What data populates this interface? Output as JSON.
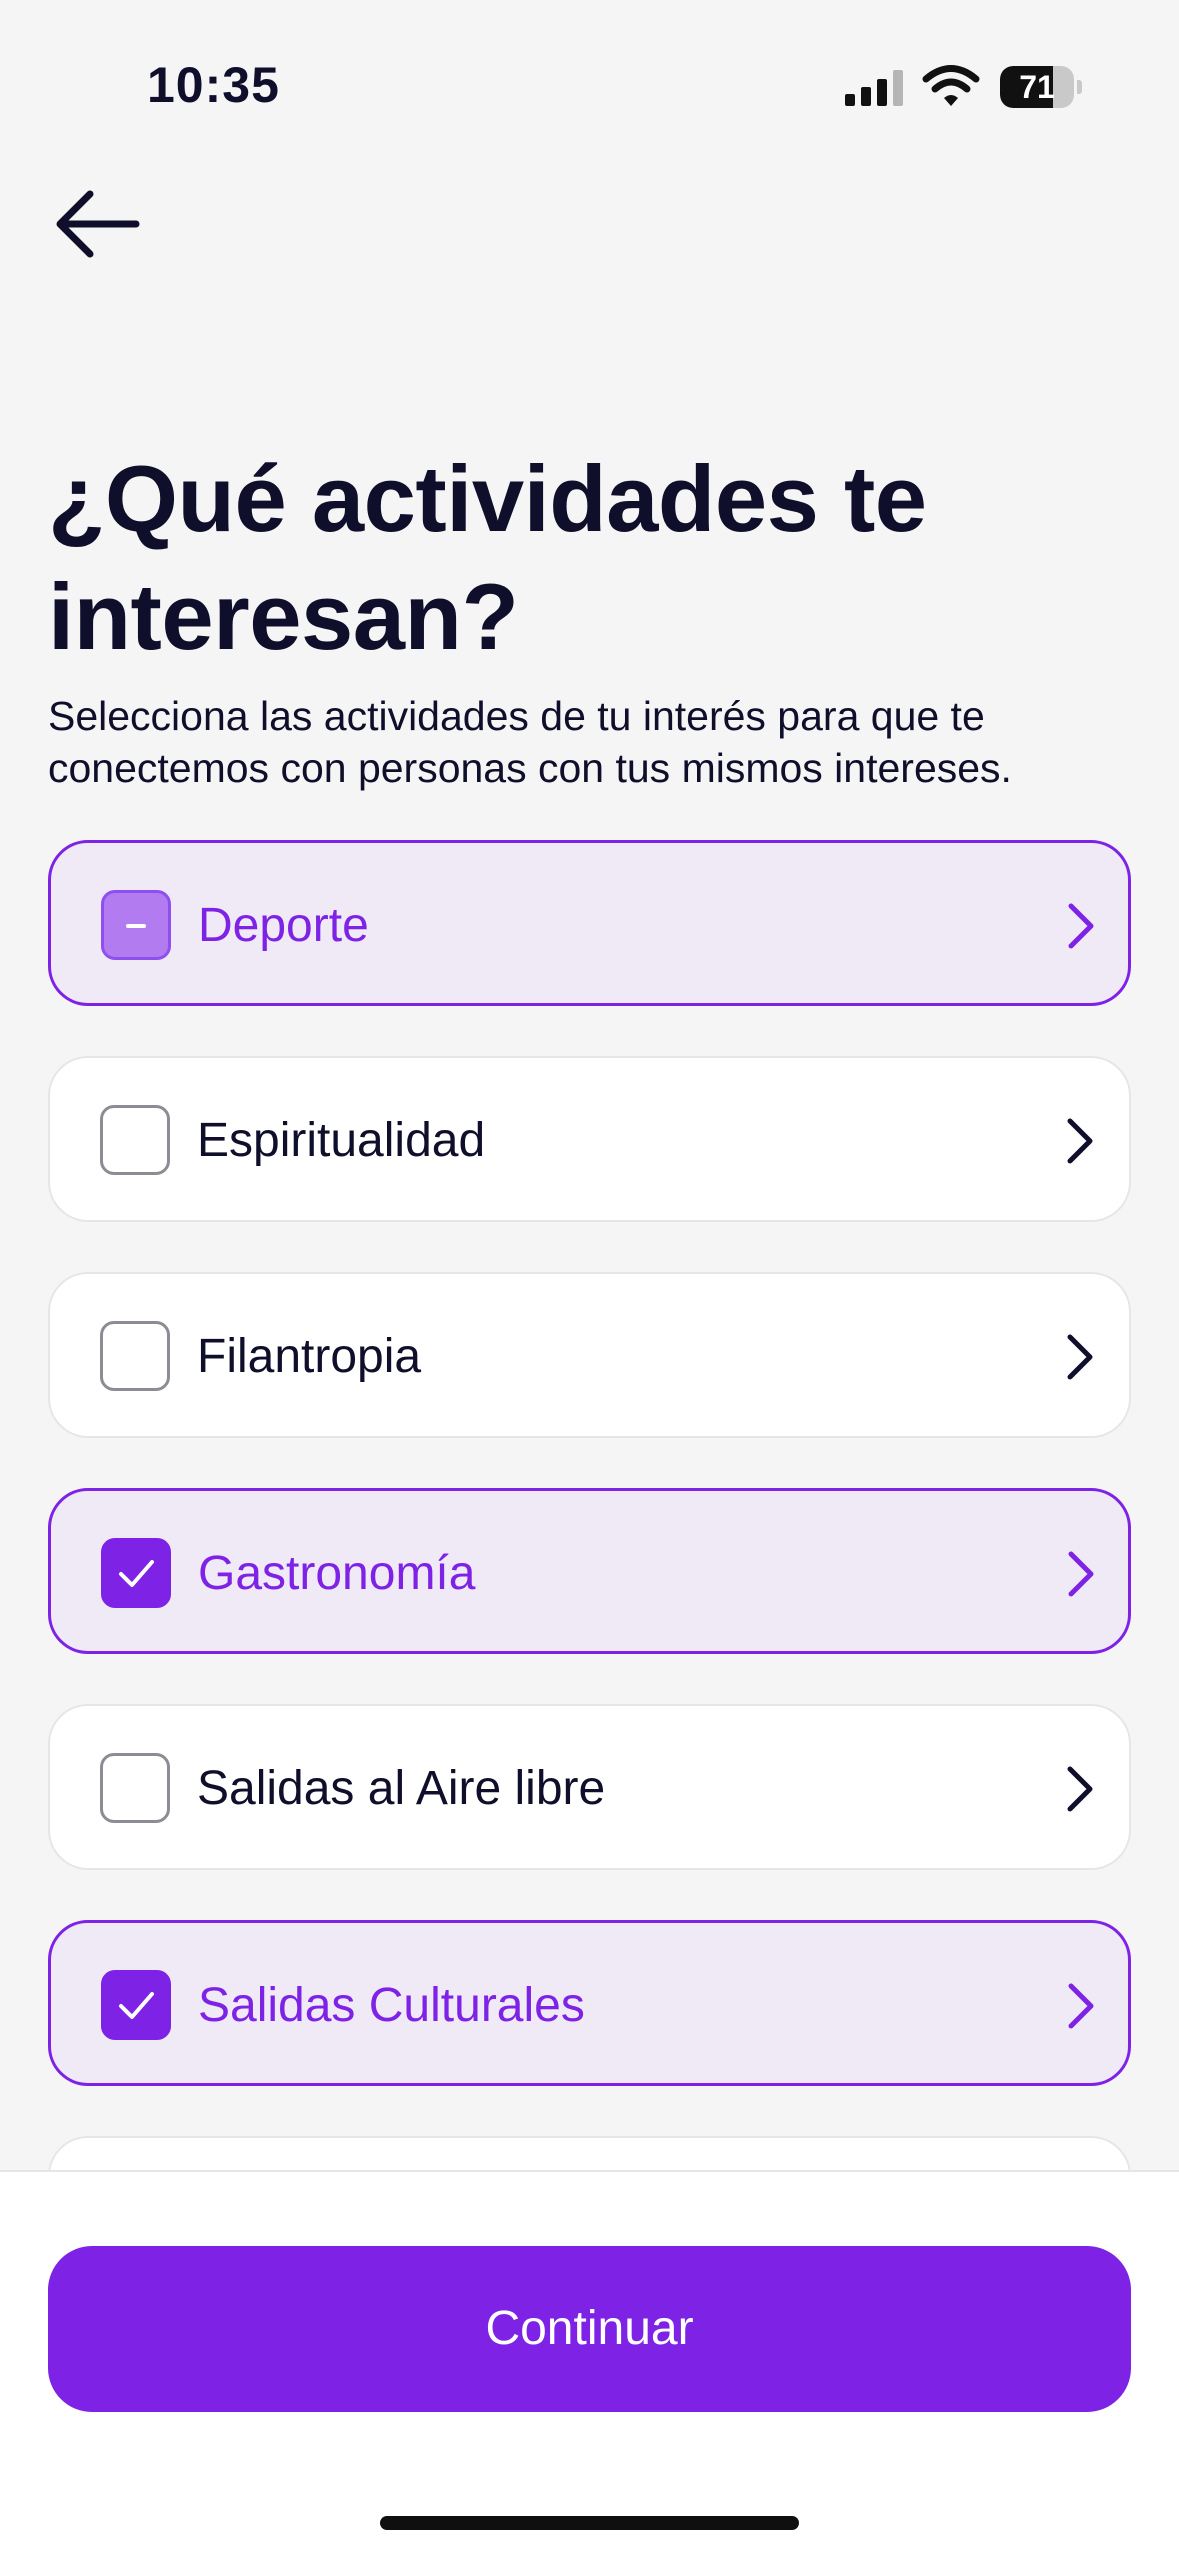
{
  "status_bar": {
    "time": "10:35",
    "battery_level": 71,
    "icons": [
      "cellular-signal-icon",
      "wifi-icon",
      "battery-icon"
    ]
  },
  "navigation": {
    "back_icon": "arrow-left-icon"
  },
  "header": {
    "title": "¿Qué actividades te interesan?",
    "subtitle": "Selecciona las actividades de tu interés para que te conectemos con personas con tus mismos intereses."
  },
  "categories": [
    {
      "label": "Deporte",
      "state": "partial"
    },
    {
      "label": "Espiritualidad",
      "state": "unchecked"
    },
    {
      "label": "Filantropia",
      "state": "unchecked"
    },
    {
      "label": "Gastronomía",
      "state": "checked"
    },
    {
      "label": "Salidas al Aire libre",
      "state": "unchecked"
    },
    {
      "label": "Salidas Culturales",
      "state": "checked"
    },
    {
      "label": "",
      "state": "unchecked"
    }
  ],
  "footer": {
    "continue_label": "Continuar"
  },
  "colors": {
    "accent": "#7e22e6",
    "selected_background": "#f0e9f6",
    "text": "#0f0f2b",
    "page_background": "#f5f5f5"
  }
}
